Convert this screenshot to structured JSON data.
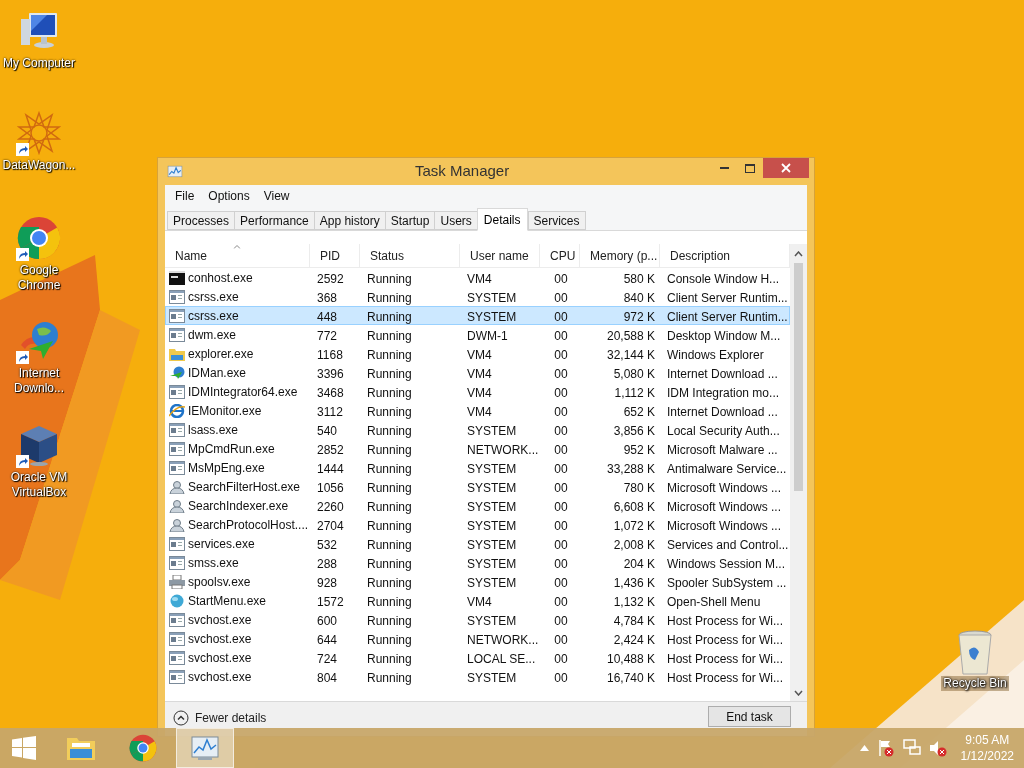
{
  "desktop_icons": [
    {
      "label": "My Computer",
      "kind": "computer",
      "shortcut": false
    },
    {
      "label": "DataWagon...",
      "kind": "star",
      "shortcut": true
    },
    {
      "label": "Google Chrome",
      "kind": "chrome",
      "shortcut": true
    },
    {
      "label": "Internet Downlo...",
      "kind": "idm",
      "shortcut": true
    },
    {
      "label": "Oracle VM VirtualBox",
      "kind": "box",
      "shortcut": true
    }
  ],
  "recycle_bin": {
    "label": "Recycle Bin"
  },
  "window": {
    "title": "Task Manager",
    "menu": [
      "File",
      "Options",
      "View"
    ],
    "tabs": [
      {
        "label": "Processes",
        "selected": false
      },
      {
        "label": "Performance",
        "selected": false
      },
      {
        "label": "App history",
        "selected": false
      },
      {
        "label": "Startup",
        "selected": false
      },
      {
        "label": "Users",
        "selected": false
      },
      {
        "label": "Details",
        "selected": true
      },
      {
        "label": "Services",
        "selected": false
      }
    ],
    "columns": [
      {
        "label": "Name",
        "sorted": true
      },
      {
        "label": "PID",
        "sorted": false
      },
      {
        "label": "Status",
        "sorted": false
      },
      {
        "label": "User name",
        "sorted": false
      },
      {
        "label": "CPU",
        "sorted": false
      },
      {
        "label": "Memory (p...",
        "sorted": false
      },
      {
        "label": "Description",
        "sorted": false
      }
    ],
    "rows": [
      {
        "kind": "console",
        "name": "conhost.exe",
        "pid": "2592",
        "status": "Running",
        "user": "VM4",
        "cpu": "00",
        "memory": "580 K",
        "description": "Console Window H...",
        "selected": false
      },
      {
        "kind": "app",
        "name": "csrss.exe",
        "pid": "368",
        "status": "Running",
        "user": "SYSTEM",
        "cpu": "00",
        "memory": "840 K",
        "description": "Client Server Runtim...",
        "selected": false
      },
      {
        "kind": "app",
        "name": "csrss.exe",
        "pid": "448",
        "status": "Running",
        "user": "SYSTEM",
        "cpu": "00",
        "memory": "972 K",
        "description": "Client Server Runtim...",
        "selected": true
      },
      {
        "kind": "app",
        "name": "dwm.exe",
        "pid": "772",
        "status": "Running",
        "user": "DWM-1",
        "cpu": "00",
        "memory": "20,588 K",
        "description": "Desktop Window M...",
        "selected": false
      },
      {
        "kind": "folder",
        "name": "explorer.exe",
        "pid": "1168",
        "status": "Running",
        "user": "VM4",
        "cpu": "00",
        "memory": "32,144 K",
        "description": "Windows Explorer",
        "selected": false
      },
      {
        "kind": "globe",
        "name": "IDMan.exe",
        "pid": "3396",
        "status": "Running",
        "user": "VM4",
        "cpu": "00",
        "memory": "5,080 K",
        "description": "Internet Download ...",
        "selected": false
      },
      {
        "kind": "app",
        "name": "IDMIntegrator64.exe",
        "pid": "3468",
        "status": "Running",
        "user": "VM4",
        "cpu": "00",
        "memory": "1,112 K",
        "description": "IDM Integration mo...",
        "selected": false
      },
      {
        "kind": "ie",
        "name": "IEMonitor.exe",
        "pid": "3112",
        "status": "Running",
        "user": "VM4",
        "cpu": "00",
        "memory": "652 K",
        "description": "Internet Download ...",
        "selected": false
      },
      {
        "kind": "app",
        "name": "lsass.exe",
        "pid": "540",
        "status": "Running",
        "user": "SYSTEM",
        "cpu": "00",
        "memory": "3,856 K",
        "description": "Local Security Auth...",
        "selected": false
      },
      {
        "kind": "app",
        "name": "MpCmdRun.exe",
        "pid": "2852",
        "status": "Running",
        "user": "NETWORK...",
        "cpu": "00",
        "memory": "952 K",
        "description": "Microsoft Malware ...",
        "selected": false
      },
      {
        "kind": "app",
        "name": "MsMpEng.exe",
        "pid": "1444",
        "status": "Running",
        "user": "SYSTEM",
        "cpu": "00",
        "memory": "33,288 K",
        "description": "Antimalware Service...",
        "selected": false
      },
      {
        "kind": "search",
        "name": "SearchFilterHost.exe",
        "pid": "1056",
        "status": "Running",
        "user": "SYSTEM",
        "cpu": "00",
        "memory": "780 K",
        "description": "Microsoft Windows ...",
        "selected": false
      },
      {
        "kind": "search",
        "name": "SearchIndexer.exe",
        "pid": "2260",
        "status": "Running",
        "user": "SYSTEM",
        "cpu": "00",
        "memory": "6,608 K",
        "description": "Microsoft Windows ...",
        "selected": false
      },
      {
        "kind": "search",
        "name": "SearchProtocolHost....",
        "pid": "2704",
        "status": "Running",
        "user": "SYSTEM",
        "cpu": "00",
        "memory": "1,072 K",
        "description": "Microsoft Windows ...",
        "selected": false
      },
      {
        "kind": "app",
        "name": "services.exe",
        "pid": "532",
        "status": "Running",
        "user": "SYSTEM",
        "cpu": "00",
        "memory": "2,008 K",
        "description": "Services and Control...",
        "selected": false
      },
      {
        "kind": "app",
        "name": "smss.exe",
        "pid": "288",
        "status": "Running",
        "user": "SYSTEM",
        "cpu": "00",
        "memory": "204 K",
        "description": "Windows Session M...",
        "selected": false
      },
      {
        "kind": "printer",
        "name": "spoolsv.exe",
        "pid": "928",
        "status": "Running",
        "user": "SYSTEM",
        "cpu": "00",
        "memory": "1,436 K",
        "description": "Spooler SubSystem ...",
        "selected": false
      },
      {
        "kind": "sphere",
        "name": "StartMenu.exe",
        "pid": "1572",
        "status": "Running",
        "user": "VM4",
        "cpu": "00",
        "memory": "1,132 K",
        "description": "Open-Shell Menu",
        "selected": false
      },
      {
        "kind": "app",
        "name": "svchost.exe",
        "pid": "600",
        "status": "Running",
        "user": "SYSTEM",
        "cpu": "00",
        "memory": "4,784 K",
        "description": "Host Process for Wi...",
        "selected": false
      },
      {
        "kind": "app",
        "name": "svchost.exe",
        "pid": "644",
        "status": "Running",
        "user": "NETWORK...",
        "cpu": "00",
        "memory": "2,424 K",
        "description": "Host Process for Wi...",
        "selected": false
      },
      {
        "kind": "app",
        "name": "svchost.exe",
        "pid": "724",
        "status": "Running",
        "user": "LOCAL SE...",
        "cpu": "00",
        "memory": "10,488 K",
        "description": "Host Process for Wi...",
        "selected": false
      },
      {
        "kind": "app",
        "name": "svchost.exe",
        "pid": "804",
        "status": "Running",
        "user": "SYSTEM",
        "cpu": "00",
        "memory": "16,740 K",
        "description": "Host Process for Wi...",
        "selected": false
      }
    ],
    "fewer_details": "Fewer details",
    "end_task": "End task"
  },
  "taskbar": {
    "items": [
      {
        "kind": "explorer",
        "active": false
      },
      {
        "kind": "chrome",
        "active": false
      },
      {
        "kind": "taskmgr",
        "active": true
      }
    ],
    "clock": {
      "time": "9:05 AM",
      "date": "1/12/2022"
    }
  }
}
